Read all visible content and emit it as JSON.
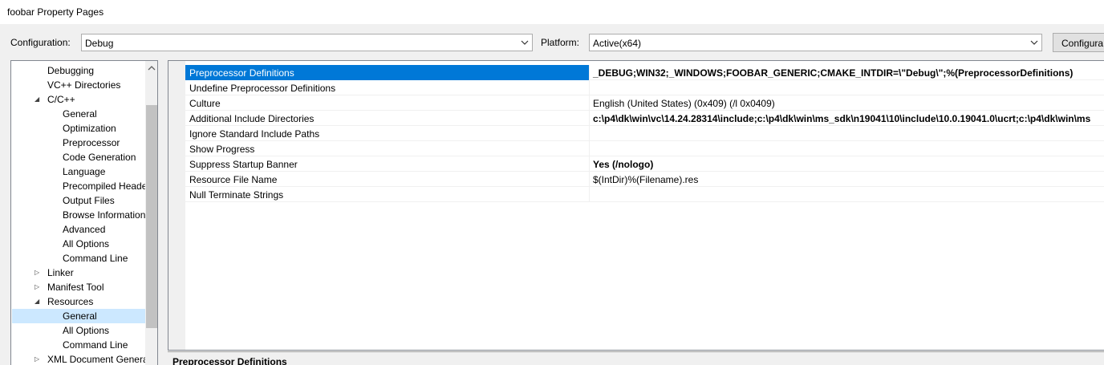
{
  "window": {
    "title": "foobar Property Pages"
  },
  "config": {
    "configuration_label": "Configuration:",
    "configuration_value": "Debug",
    "platform_label": "Platform:",
    "platform_value": "Active(x64)",
    "config_manager_button": "Configura"
  },
  "tree": {
    "items": [
      {
        "label": "Debugging",
        "level": 1,
        "expander": ""
      },
      {
        "label": "VC++ Directories",
        "level": 1,
        "expander": ""
      },
      {
        "label": "C/C++",
        "level": 1,
        "expander": "expanded"
      },
      {
        "label": "General",
        "level": 2,
        "expander": ""
      },
      {
        "label": "Optimization",
        "level": 2,
        "expander": ""
      },
      {
        "label": "Preprocessor",
        "level": 2,
        "expander": ""
      },
      {
        "label": "Code Generation",
        "level": 2,
        "expander": ""
      },
      {
        "label": "Language",
        "level": 2,
        "expander": ""
      },
      {
        "label": "Precompiled Heade",
        "level": 2,
        "expander": ""
      },
      {
        "label": "Output Files",
        "level": 2,
        "expander": ""
      },
      {
        "label": "Browse Information",
        "level": 2,
        "expander": ""
      },
      {
        "label": "Advanced",
        "level": 2,
        "expander": ""
      },
      {
        "label": "All Options",
        "level": 2,
        "expander": ""
      },
      {
        "label": "Command Line",
        "level": 2,
        "expander": ""
      },
      {
        "label": "Linker",
        "level": 1,
        "expander": "collapsed"
      },
      {
        "label": "Manifest Tool",
        "level": 1,
        "expander": "collapsed"
      },
      {
        "label": "Resources",
        "level": 1,
        "expander": "expanded"
      },
      {
        "label": "General",
        "level": 2,
        "expander": "",
        "selected": true
      },
      {
        "label": "All Options",
        "level": 2,
        "expander": ""
      },
      {
        "label": "Command Line",
        "level": 2,
        "expander": ""
      },
      {
        "label": "XML Document Genera",
        "level": 1,
        "expander": "collapsed"
      }
    ]
  },
  "properties": [
    {
      "name": "Preprocessor Definitions",
      "value": "_DEBUG;WIN32;_WINDOWS;FOOBAR_GENERIC;CMAKE_INTDIR=\\\"Debug\\\";%(PreprocessorDefinitions)",
      "bold": true,
      "selected": true
    },
    {
      "name": "Undefine Preprocessor Definitions",
      "value": "",
      "bold": false
    },
    {
      "name": "Culture",
      "value": "English (United States) (0x409) (/l 0x0409)",
      "bold": false
    },
    {
      "name": "Additional Include Directories",
      "value": "c:\\p4\\dk\\win\\vc\\14.24.28314\\include;c:\\p4\\dk\\win\\ms_sdk\\n19041\\10\\include\\10.0.19041.0\\ucrt;c:\\p4\\dk\\win\\ms",
      "bold": true
    },
    {
      "name": "Ignore Standard Include Paths",
      "value": "",
      "bold": false
    },
    {
      "name": "Show Progress",
      "value": "",
      "bold": false
    },
    {
      "name": "Suppress Startup Banner",
      "value": "Yes (/nologo)",
      "bold": true
    },
    {
      "name": "Resource File Name",
      "value": "$(IntDir)%(Filename).res",
      "bold": false
    },
    {
      "name": "Null Terminate Strings",
      "value": "",
      "bold": false
    }
  ],
  "description": {
    "title": "Preprocessor Definitions"
  },
  "colors": {
    "selection": "#0078d7",
    "tree_selection": "#cce8ff"
  }
}
